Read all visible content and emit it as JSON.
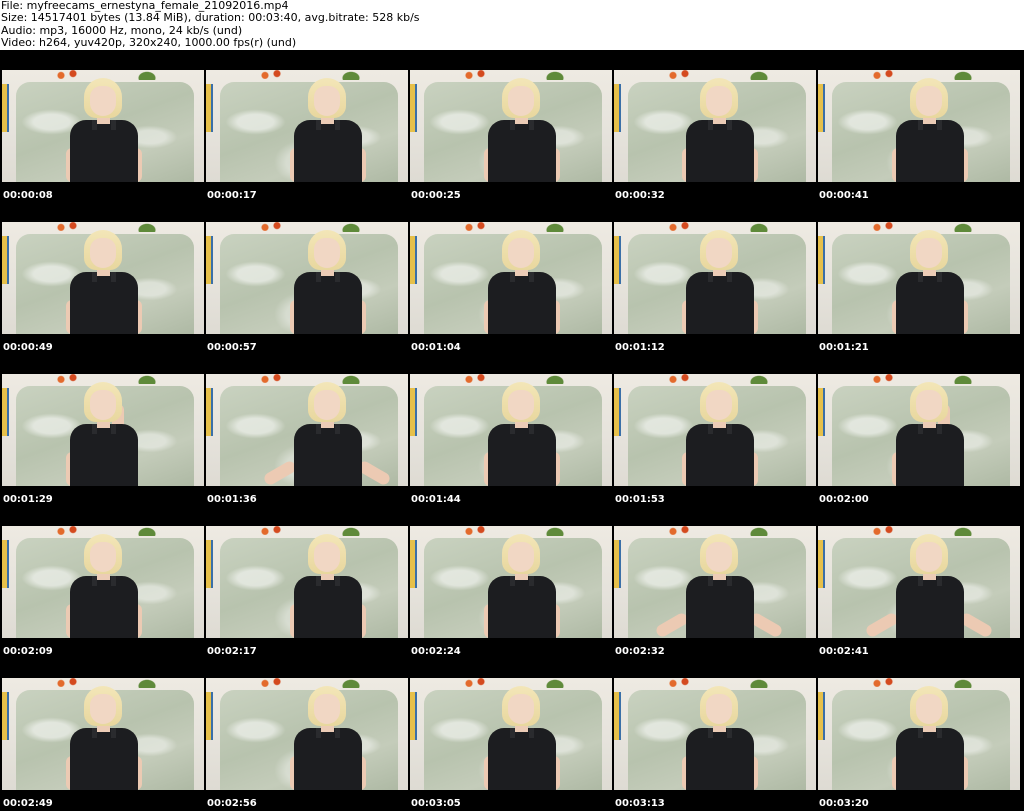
{
  "header": {
    "file_line": "File: myfreecams_ernestyna_female_21092016.mp4",
    "size_line": "Size: 14517401 bytes (13.84 MiB), duration: 00:03:40, avg.bitrate: 528 kb/s",
    "audio_line": "Audio: mp3, 16000 Hz, mono, 24 kb/s (und)",
    "video_line": "Video: h264, yuv420p, 320x240, 1000.00 fps(r) (und)"
  },
  "thumbnails": [
    {
      "timestamp": "00:00:08"
    },
    {
      "timestamp": "00:00:17"
    },
    {
      "timestamp": "00:00:25"
    },
    {
      "timestamp": "00:00:32"
    },
    {
      "timestamp": "00:00:41"
    },
    {
      "timestamp": "00:00:49"
    },
    {
      "timestamp": "00:00:57"
    },
    {
      "timestamp": "00:01:04"
    },
    {
      "timestamp": "00:01:12"
    },
    {
      "timestamp": "00:01:21"
    },
    {
      "timestamp": "00:01:29"
    },
    {
      "timestamp": "00:01:36"
    },
    {
      "timestamp": "00:01:44"
    },
    {
      "timestamp": "00:01:53"
    },
    {
      "timestamp": "00:02:00"
    },
    {
      "timestamp": "00:02:09"
    },
    {
      "timestamp": "00:02:17"
    },
    {
      "timestamp": "00:02:24"
    },
    {
      "timestamp": "00:02:32"
    },
    {
      "timestamp": "00:02:41"
    },
    {
      "timestamp": "00:02:49"
    },
    {
      "timestamp": "00:02:56"
    },
    {
      "timestamp": "00:03:05"
    },
    {
      "timestamp": "00:03:13"
    },
    {
      "timestamp": "00:03:20"
    }
  ],
  "colors": {
    "sheet_background": "#000000",
    "header_background": "#ffffff",
    "header_text": "#000000",
    "timestamp_text": "#ffffff"
  }
}
